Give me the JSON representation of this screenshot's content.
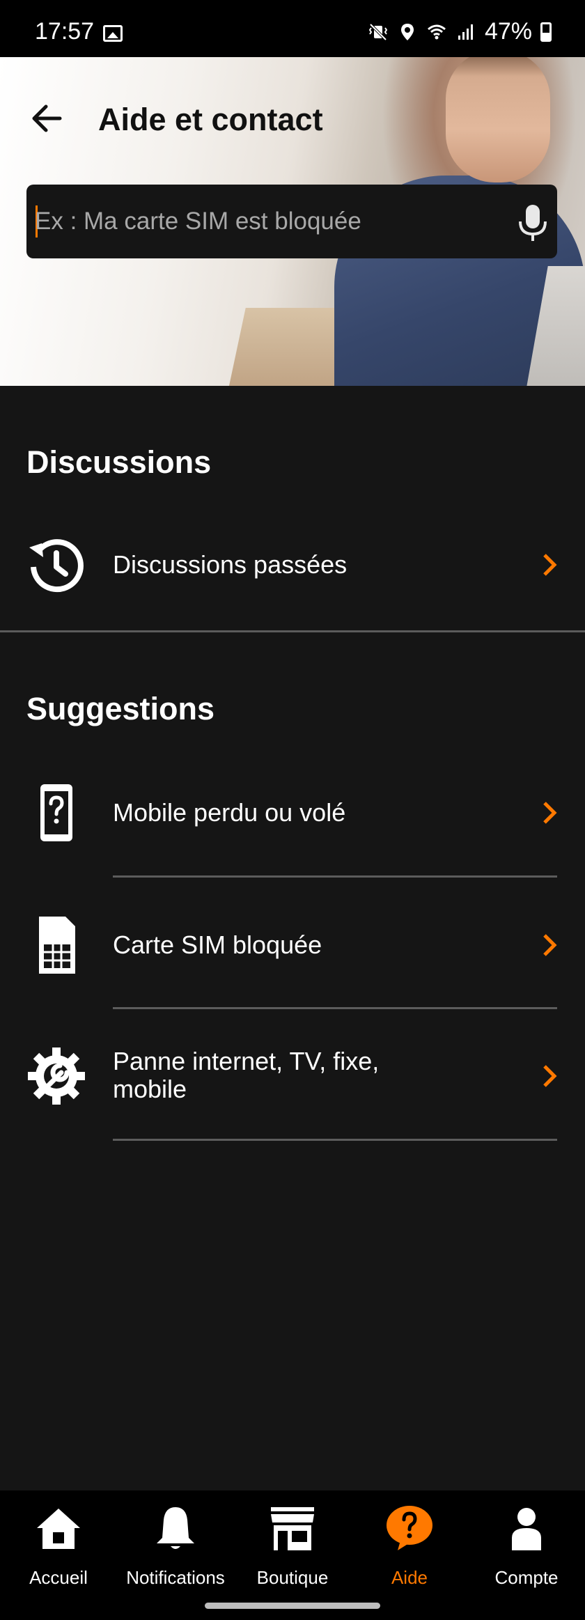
{
  "status_bar": {
    "time": "17:57",
    "battery": "47%"
  },
  "header": {
    "title": "Aide et contact"
  },
  "search": {
    "placeholder": "Ex : Ma carte SIM est bloquée"
  },
  "discussions": {
    "title": "Discussions",
    "items": [
      {
        "label": "Discussions passées",
        "icon": "history-icon"
      }
    ]
  },
  "suggestions": {
    "title": "Suggestions",
    "items": [
      {
        "label": "Mobile perdu ou volé",
        "icon": "phone-question-icon"
      },
      {
        "label": "Carte SIM bloquée",
        "icon": "sim-card-icon"
      },
      {
        "label_line1": "Panne internet, TV, fixe,",
        "label_line2": "mobile",
        "icon": "gear-wrench-icon"
      }
    ]
  },
  "bottom_nav": {
    "items": [
      {
        "label": "Accueil",
        "icon": "home-icon"
      },
      {
        "label": "Notifications",
        "icon": "bell-icon"
      },
      {
        "label": "Boutique",
        "icon": "shop-icon"
      },
      {
        "label": "Aide",
        "icon": "help-icon",
        "active": true
      },
      {
        "label": "Compte",
        "icon": "user-icon"
      }
    ]
  },
  "colors": {
    "accent": "#ff7900",
    "background": "#151515",
    "divider": "#5c5c5c"
  }
}
